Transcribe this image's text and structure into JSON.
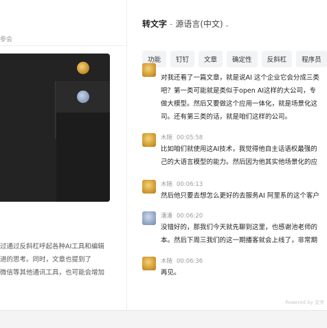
{
  "left": {
    "top_text": "参会",
    "summary_lines": [
      "过通过反斜杠呼起各种AI工具和编辑",
      "进的思考。同时，文章也提到了",
      "微信等其他通讯工具，也可能会增加"
    ]
  },
  "header": {
    "title": "转文字",
    "separator": "-",
    "language": "源语言(中文)",
    "chevron": "⌄"
  },
  "tabs": [
    "功能",
    "钉钉",
    "文章",
    "确定性",
    "反斜杠",
    "程序员"
  ],
  "messages": [
    {
      "speaker": "",
      "time": "",
      "avatar": "gold",
      "lines": [
        "对我还看了一篇文章，就是说AI 这个企业它会分成三类",
        "吧？第一类可能就是类似于open  AI这样的大公司，专",
        "做大模型。然后又要做这个应用一体化，就是场景化这",
        "司。还有第三类的话，就是咱们这样的公司。"
      ]
    },
    {
      "speaker": "木随",
      "time": "00:05:58",
      "avatar": "gold",
      "lines": [
        "比如咱们就使用这AI技术，我觉得他自主话语权最强的",
        "己的大语言模型的能力。然后因为他其实他场景化的应"
      ]
    },
    {
      "speaker": "木随",
      "time": "00:06:13",
      "avatar": "gold",
      "lines": [
        "然后他只要去想怎么更好的去服务AI 阿里系的这个客户"
      ]
    },
    {
      "speaker": "潘潘",
      "time": "00:06:20",
      "avatar": "blue",
      "lines": [
        "没错好的，那我们今天就先聊到这里，也感谢池老师的",
        "本。然后下周三我们的这一期播客就会上线了，非常期"
      ]
    },
    {
      "speaker": "木随",
      "time": "00:06:36",
      "avatar": "gold",
      "lines": [
        "再见。"
      ]
    }
  ],
  "watermark": "Powered by 文字"
}
